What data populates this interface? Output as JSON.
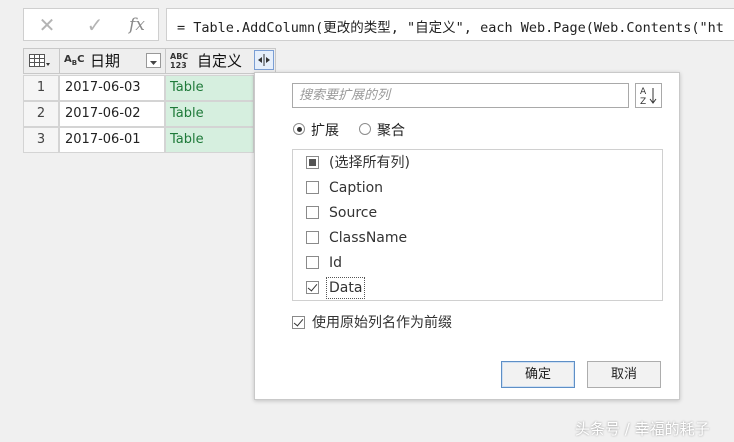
{
  "formula_bar": {
    "cancel_icon": "close-icon",
    "confirm_icon": "check-icon",
    "fx_label": "fx",
    "formula": "= Table.AddColumn(更改的类型, \"自定义\", each Web.Page(Web.Contents(\"ht"
  },
  "grid": {
    "columns": [
      {
        "type_icon": "ABC",
        "name": "日期"
      },
      {
        "type_icon": "ABC 123",
        "name": "自定义"
      }
    ],
    "rows": [
      {
        "num": "1",
        "date": "2017-06-03",
        "custom": "Table"
      },
      {
        "num": "2",
        "date": "2017-06-02",
        "custom": "Table"
      },
      {
        "num": "3",
        "date": "2017-06-01",
        "custom": "Table"
      }
    ]
  },
  "popup": {
    "search_placeholder": "搜索要扩展的列",
    "radio_expand": "扩展",
    "radio_aggregate": "聚合",
    "selected_radio": "扩展",
    "items": [
      {
        "label": "(选择所有列)",
        "state": "partial"
      },
      {
        "label": "Caption",
        "state": "unchecked"
      },
      {
        "label": "Source",
        "state": "unchecked"
      },
      {
        "label": "ClassName",
        "state": "unchecked"
      },
      {
        "label": "Id",
        "state": "unchecked"
      },
      {
        "label": "Data",
        "state": "checked"
      }
    ],
    "use_prefix_label": "使用原始列名作为前缀",
    "use_prefix_checked": true,
    "ok_label": "确定",
    "cancel_label": "取消"
  },
  "watermark": "头条号 / 幸福的耗子",
  "colors": {
    "table_cell_bg": "#d6efdf",
    "table_cell_text": "#1f7a3a",
    "primary_button_border": "#5e8fc6"
  }
}
